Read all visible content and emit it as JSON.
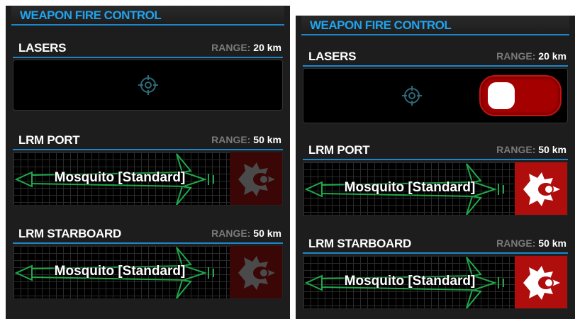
{
  "panels": [
    {
      "title": "WEAPON FIRE CONTROL",
      "lasers": {
        "name": "LASERS",
        "range_label": "RANGE:",
        "range_value": "20 km",
        "toggle_visible": false
      },
      "lrm_port": {
        "name": "LRM PORT",
        "range_label": "RANGE:",
        "range_value": "50 km",
        "missile": "Mosquito [Standard]",
        "fire_active": false
      },
      "lrm_starboard": {
        "name": "LRM STARBOARD",
        "range_label": "RANGE:",
        "range_value": "50 km",
        "missile": "Mosquito [Standard]",
        "fire_active": false
      }
    },
    {
      "title": "WEAPON FIRE CONTROL",
      "lasers": {
        "name": "LASERS",
        "range_label": "RANGE:",
        "range_value": "20 km",
        "toggle_visible": true
      },
      "lrm_port": {
        "name": "LRM PORT",
        "range_label": "RANGE:",
        "range_value": "50 km",
        "missile": "Mosquito [Standard]",
        "fire_active": true
      },
      "lrm_starboard": {
        "name": "LRM STARBOARD",
        "range_label": "RANGE:",
        "range_value": "50 km",
        "missile": "Mosquito [Standard]",
        "fire_active": true
      }
    }
  ],
  "icons": {
    "crosshair": "crosshair-icon",
    "fire": "missile-fire-icon"
  },
  "colors": {
    "accent_blue": "#1fa3ee",
    "divider_blue": "#1e86c8",
    "missile_green": "#1fa84a",
    "fire_red_active": "#b00d0d",
    "fire_red_inactive": "#3a0606",
    "toggle_red": "#a40000"
  }
}
